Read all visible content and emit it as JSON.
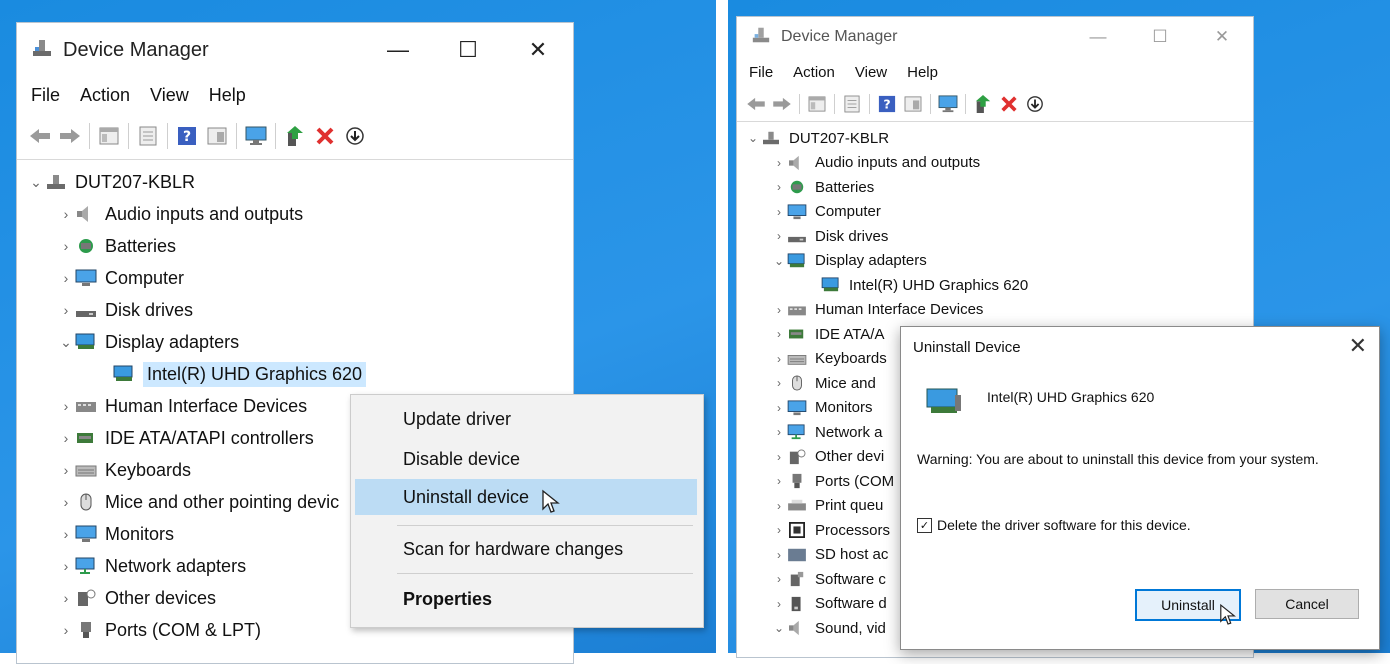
{
  "colors": {
    "desktop": "#1a8be0",
    "selection": "#cce8ff",
    "menu_highlight": "#bcdcf4",
    "delete_red": "#e0302f",
    "accent": "#0078d7"
  },
  "window": {
    "title": "Device Manager",
    "menu": [
      "File",
      "Action",
      "View",
      "Help"
    ],
    "toolbar_icons": [
      "back-arrow-icon",
      "forward-arrow-icon",
      "show-hide-tree-icon",
      "properties-icon",
      "help-icon",
      "view-icon",
      "monitor-icon",
      "update-driver-icon",
      "uninstall-x-icon",
      "download-icon"
    ],
    "root": "DUT207-KBLR"
  },
  "left_tree": [
    {
      "label": "Audio inputs and outputs",
      "icon": "speaker-icon",
      "expanded": false
    },
    {
      "label": "Batteries",
      "icon": "battery-icon",
      "expanded": false
    },
    {
      "label": "Computer",
      "icon": "monitor-icon",
      "expanded": false
    },
    {
      "label": "Disk drives",
      "icon": "disk-icon",
      "expanded": false
    },
    {
      "label": "Display adapters",
      "icon": "display-adapter-icon",
      "expanded": true
    },
    {
      "label": "Intel(R) UHD Graphics 620",
      "icon": "display-adapter-icon",
      "child": true,
      "selected": true
    },
    {
      "label": "Human Interface Devices",
      "icon": "hid-icon",
      "expanded": false
    },
    {
      "label": "IDE ATA/ATAPI controllers",
      "icon": "ide-icon",
      "expanded": false
    },
    {
      "label": "Keyboards",
      "icon": "keyboard-icon",
      "expanded": false
    },
    {
      "label": "Mice and other pointing devic",
      "icon": "mouse-icon",
      "expanded": false
    },
    {
      "label": "Monitors",
      "icon": "monitor-icon",
      "expanded": false
    },
    {
      "label": "Network adapters",
      "icon": "network-icon",
      "expanded": false
    },
    {
      "label": "Other devices",
      "icon": "unknown-device-icon",
      "expanded": false
    },
    {
      "label": "Ports (COM & LPT)",
      "icon": "port-icon",
      "expanded": false
    }
  ],
  "context_menu": {
    "items": [
      "Update driver",
      "Disable device",
      "Uninstall device",
      "Scan for hardware changes",
      "Properties"
    ]
  },
  "right_tree": [
    {
      "label": "Audio inputs and outputs",
      "icon": "speaker-icon",
      "expanded": false
    },
    {
      "label": "Batteries",
      "icon": "battery-icon",
      "expanded": false
    },
    {
      "label": "Computer",
      "icon": "monitor-icon",
      "expanded": false
    },
    {
      "label": "Disk drives",
      "icon": "disk-icon",
      "expanded": false
    },
    {
      "label": "Display adapters",
      "icon": "display-adapter-icon",
      "expanded": true
    },
    {
      "label": "Intel(R) UHD Graphics 620",
      "icon": "display-adapter-icon",
      "child": true
    },
    {
      "label": "Human Interface Devices",
      "icon": "hid-icon",
      "expanded": false
    },
    {
      "label": "IDE ATA/A",
      "icon": "ide-icon",
      "expanded": false
    },
    {
      "label": "Keyboards",
      "icon": "keyboard-icon",
      "expanded": false
    },
    {
      "label": "Mice and",
      "icon": "mouse-icon",
      "expanded": false
    },
    {
      "label": "Monitors",
      "icon": "monitor-icon",
      "expanded": false
    },
    {
      "label": "Network a",
      "icon": "network-icon",
      "expanded": false
    },
    {
      "label": "Other devi",
      "icon": "unknown-device-icon",
      "expanded": false
    },
    {
      "label": "Ports (COM",
      "icon": "port-icon",
      "expanded": false
    },
    {
      "label": "Print queu",
      "icon": "printer-icon",
      "expanded": false
    },
    {
      "label": "Processors",
      "icon": "processor-icon",
      "expanded": false
    },
    {
      "label": "SD host ac",
      "icon": "sd-icon",
      "expanded": false
    },
    {
      "label": "Software c",
      "icon": "software-icon",
      "expanded": false
    },
    {
      "label": "Software d",
      "icon": "software-device-icon",
      "expanded": false
    },
    {
      "label": "Sound, vid",
      "icon": "speaker-icon",
      "expanded": true
    }
  ],
  "dialog": {
    "title": "Uninstall Device",
    "device_name": "Intel(R) UHD Graphics 620",
    "warning": "Warning: You are about to uninstall this device from your system.",
    "checkbox_label": "Delete the driver software for this device.",
    "checkbox_checked": true,
    "uninstall_label": "Uninstall",
    "cancel_label": "Cancel"
  }
}
